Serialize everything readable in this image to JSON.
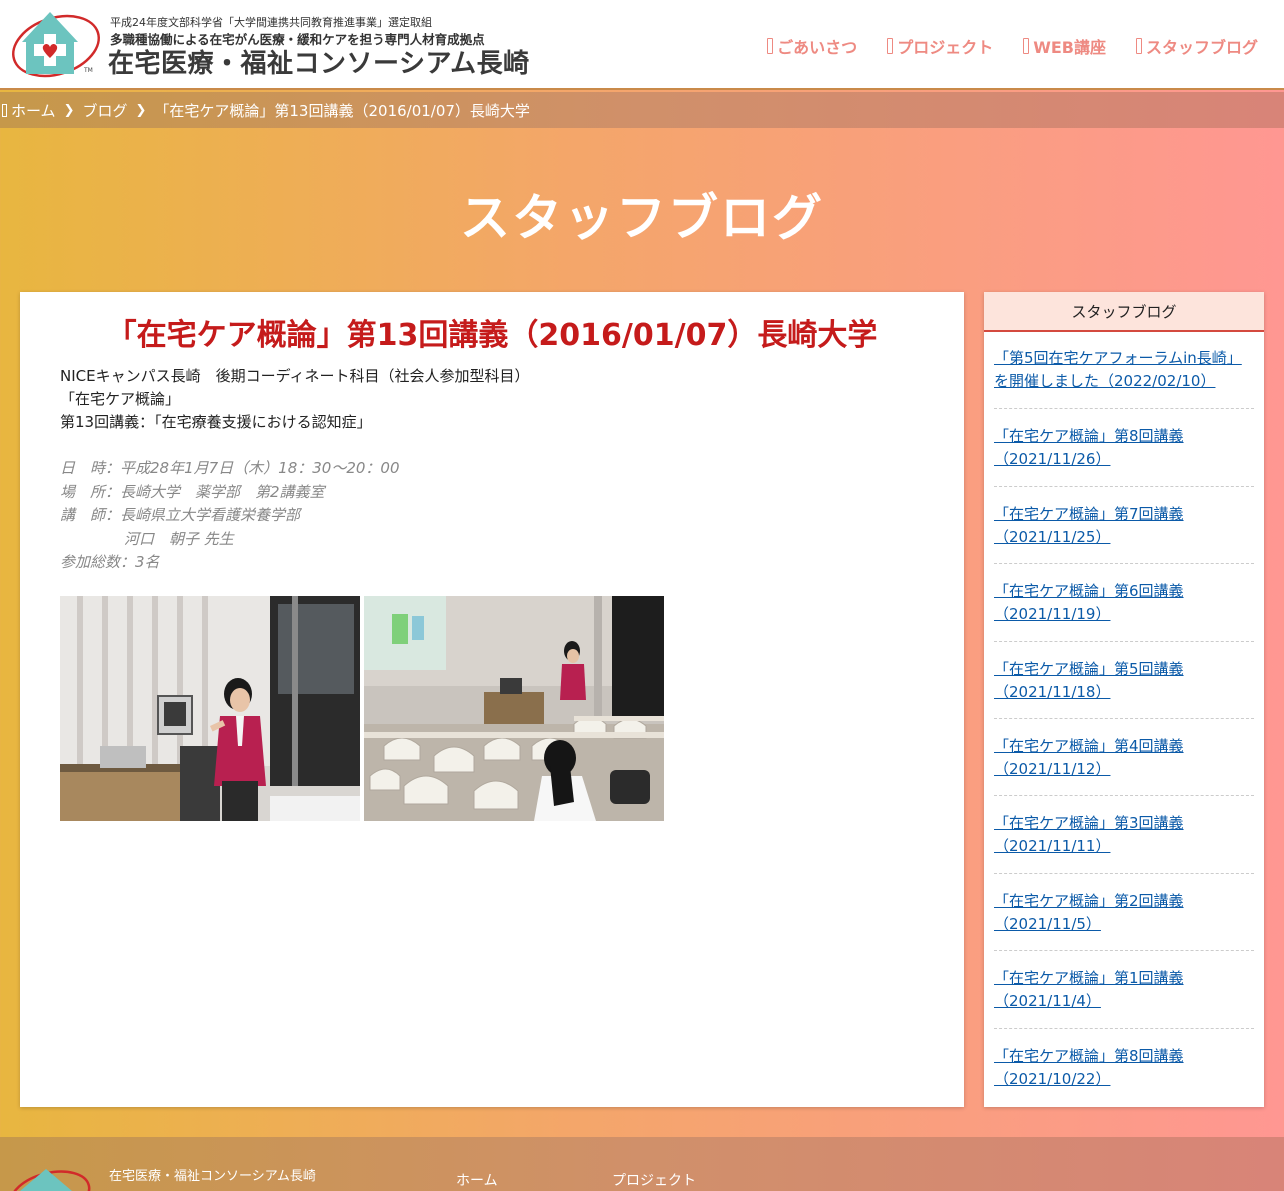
{
  "header": {
    "logo_small": "平成24年度文部科学省「大学間連携共同教育推進事業」選定取組",
    "logo_sub": "多職種協働による在宅がん医療・緩和ケアを担う専門人材育成拠点",
    "logo_title": "在宅医療・福祉コンソーシアム長崎",
    "logo_tm": "TM",
    "nav": [
      "ごあいさつ",
      "プロジェクト",
      "WEB講座",
      "スタッフブログ"
    ]
  },
  "breadcrumb": {
    "items": [
      "ホーム",
      "ブログ",
      "「在宅ケア概論」第13回講義（2016/01/07）長崎大学"
    ]
  },
  "page_heading": "スタッフブログ",
  "article": {
    "title": "「在宅ケア概論」第13回講義（2016/01/07）長崎大学",
    "intro": [
      "NICEキャンパス長崎　後期コーディネート科目（社会人参加型科目）",
      "「在宅ケア概論」",
      "第13回講義：「在宅療養支援における認知症」"
    ],
    "details": {
      "date": "日　時：平成28年1月7日（木）18：30〜20：00",
      "place": "場　所：長崎大学　薬学部　第2講義室",
      "lecturer": "講　師：長崎県立大学看護栄養学部",
      "lecturer_name": "河口　朝子 先生",
      "attendees": "参加総数：3名"
    }
  },
  "sidebar": {
    "title": "スタッフブログ",
    "posts": [
      "「第5回在宅ケアフォーラムin長崎」を開催しました（2022/02/10）",
      "「在宅ケア概論」第8回講義（2021/11/26）",
      "「在宅ケア概論」第7回講義（2021/11/25）",
      "「在宅ケア概論」第6回講義（2021/11/19）",
      "「在宅ケア概論」第5回講義（2021/11/18）",
      "「在宅ケア概論」第4回講義（2021/11/12）",
      "「在宅ケア概論」第3回講義（2021/11/11）",
      "「在宅ケア概論」第2回講義（2021/11/5）",
      "「在宅ケア概論」第1回講義（2021/11/4）",
      "「在宅ケア概論」第8回講義（2021/10/22）"
    ]
  },
  "footer": {
    "name": "在宅医療・福祉コンソーシアム長崎",
    "links": [
      "ホーム",
      "プロジェクト"
    ]
  },
  "colors": {
    "accent_red": "#c51b1b",
    "nav_pink": "#ee8a82",
    "link_blue": "#0b5aa8",
    "logo_teal": "#6cc4bf"
  }
}
